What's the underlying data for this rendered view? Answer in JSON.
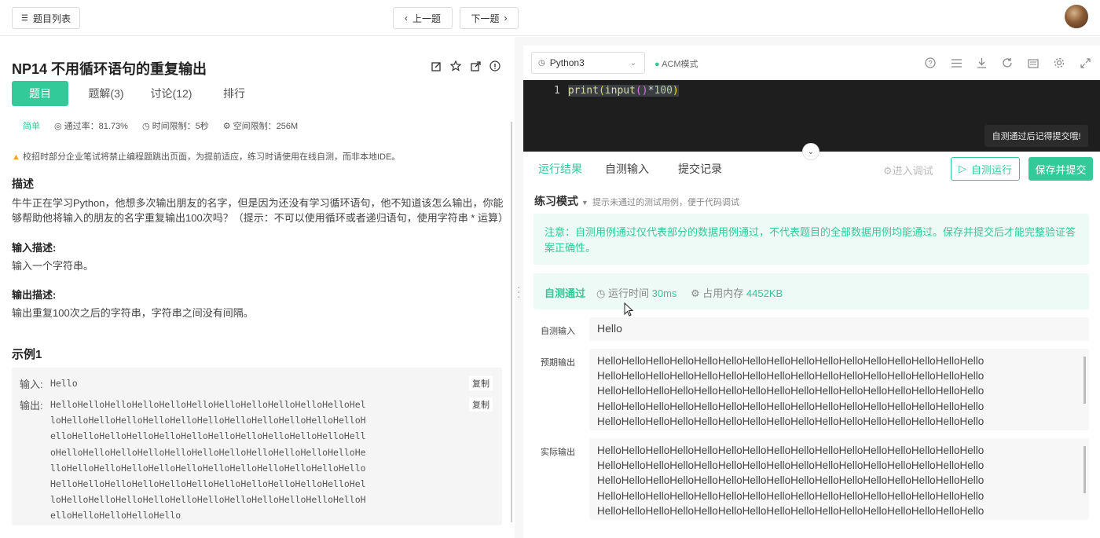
{
  "topbar": {
    "problem_list": "题目列表",
    "prev": "上一题",
    "next": "下一题"
  },
  "problem": {
    "title": "NP14  不用循环语句的重复输出",
    "tabs": [
      "题目",
      "题解(3)",
      "讨论(12)",
      "排行"
    ],
    "difficulty": "简单",
    "pass_rate": "通过率：81.73%",
    "time_limit": "时间限制：5秒",
    "space_limit": "空间限制：256M",
    "warning": "校招时部分企业笔试将禁止编程题跳出页面，为提前适应，练习时请使用在线自测，而非本地IDE。",
    "desc_heading": "描述",
    "desc_line1": "牛牛正在学习Python，他想多次输出朋友的名字，但是因为还没有学习循环语句，他不知道该怎么输出，你能",
    "desc_line2": "够帮助他将输入的朋友的名字重复输出100次吗？（提示：不可以使用循环或者递归语句，使用字符串 * 运算）",
    "input_heading": "输入描述:",
    "input_desc": "输入一个字符串。",
    "output_heading": "输出描述:",
    "output_desc": "输出重复100次之后的字符串，字符串之间没有间隔。",
    "example_heading": "示例1",
    "example_input_label": "输入:",
    "example_input": "Hello",
    "example_output_label": "输出:",
    "example_output_lines": [
      "HelloHelloHelloHelloHelloHelloHelloHelloHelloHelloHelloHel",
      "loHelloHelloHelloHelloHelloHelloHelloHelloHelloHelloHelloH",
      "elloHelloHelloHelloHelloHelloHelloHelloHelloHelloHelloHell",
      "oHelloHelloHelloHelloHelloHelloHelloHelloHelloHelloHelloHe",
      "lloHelloHelloHelloHelloHelloHelloHelloHelloHelloHelloHello",
      "HelloHelloHelloHelloHelloHelloHelloHelloHelloHelloHelloHel",
      "loHelloHelloHelloHelloHelloHelloHelloHelloHelloHelloHelloH",
      "elloHelloHelloHelloHello"
    ],
    "copy": "复制"
  },
  "editor": {
    "language": "Python3",
    "mode": "ACM模式",
    "line_number": "1",
    "code_fn": "print",
    "code_open": "(",
    "code_inner": "input",
    "code_call": "()",
    "code_op": "*",
    "code_num": "100",
    "code_close": ")",
    "tooltip": "自测通过后记得提交哦!"
  },
  "result": {
    "tabs": [
      "运行结果",
      "自测输入",
      "提交记录"
    ],
    "debug": "进入调试",
    "self_run": "自测运行",
    "submit": "保存并提交",
    "practice_mode": "练习模式",
    "practice_hint": "提示未通过的测试用例，便于代码调试",
    "notice": "注意：自测用例通过仅代表部分的数据用例通过，不代表题目的全部数据用例均能通过。保存并提交后才能完整验证答案正确性。",
    "status": "自测通过",
    "run_time_label": "运行时间",
    "run_time": "30ms",
    "memory_label": "占用内存",
    "memory": "4452KB",
    "input_label": "自测输入",
    "input_value": "Hello",
    "expected_label": "预期输出",
    "actual_label": "实际输出",
    "output_lines": [
      "HelloHelloHelloHelloHelloHelloHelloHelloHelloHelloHelloHelloHelloHelloHelloHello",
      "HelloHelloHelloHelloHelloHelloHelloHelloHelloHelloHelloHelloHelloHelloHelloHello",
      "HelloHelloHelloHelloHelloHelloHelloHelloHelloHelloHelloHelloHelloHelloHelloHello",
      "HelloHelloHelloHelloHelloHelloHelloHelloHelloHelloHelloHelloHelloHelloHelloHello",
      "HelloHelloHelloHelloHelloHelloHelloHelloHelloHelloHelloHelloHelloHelloHelloHello"
    ]
  },
  "colors": {
    "accent": "#32ca99",
    "editor_bg": "#1e1e1e"
  }
}
